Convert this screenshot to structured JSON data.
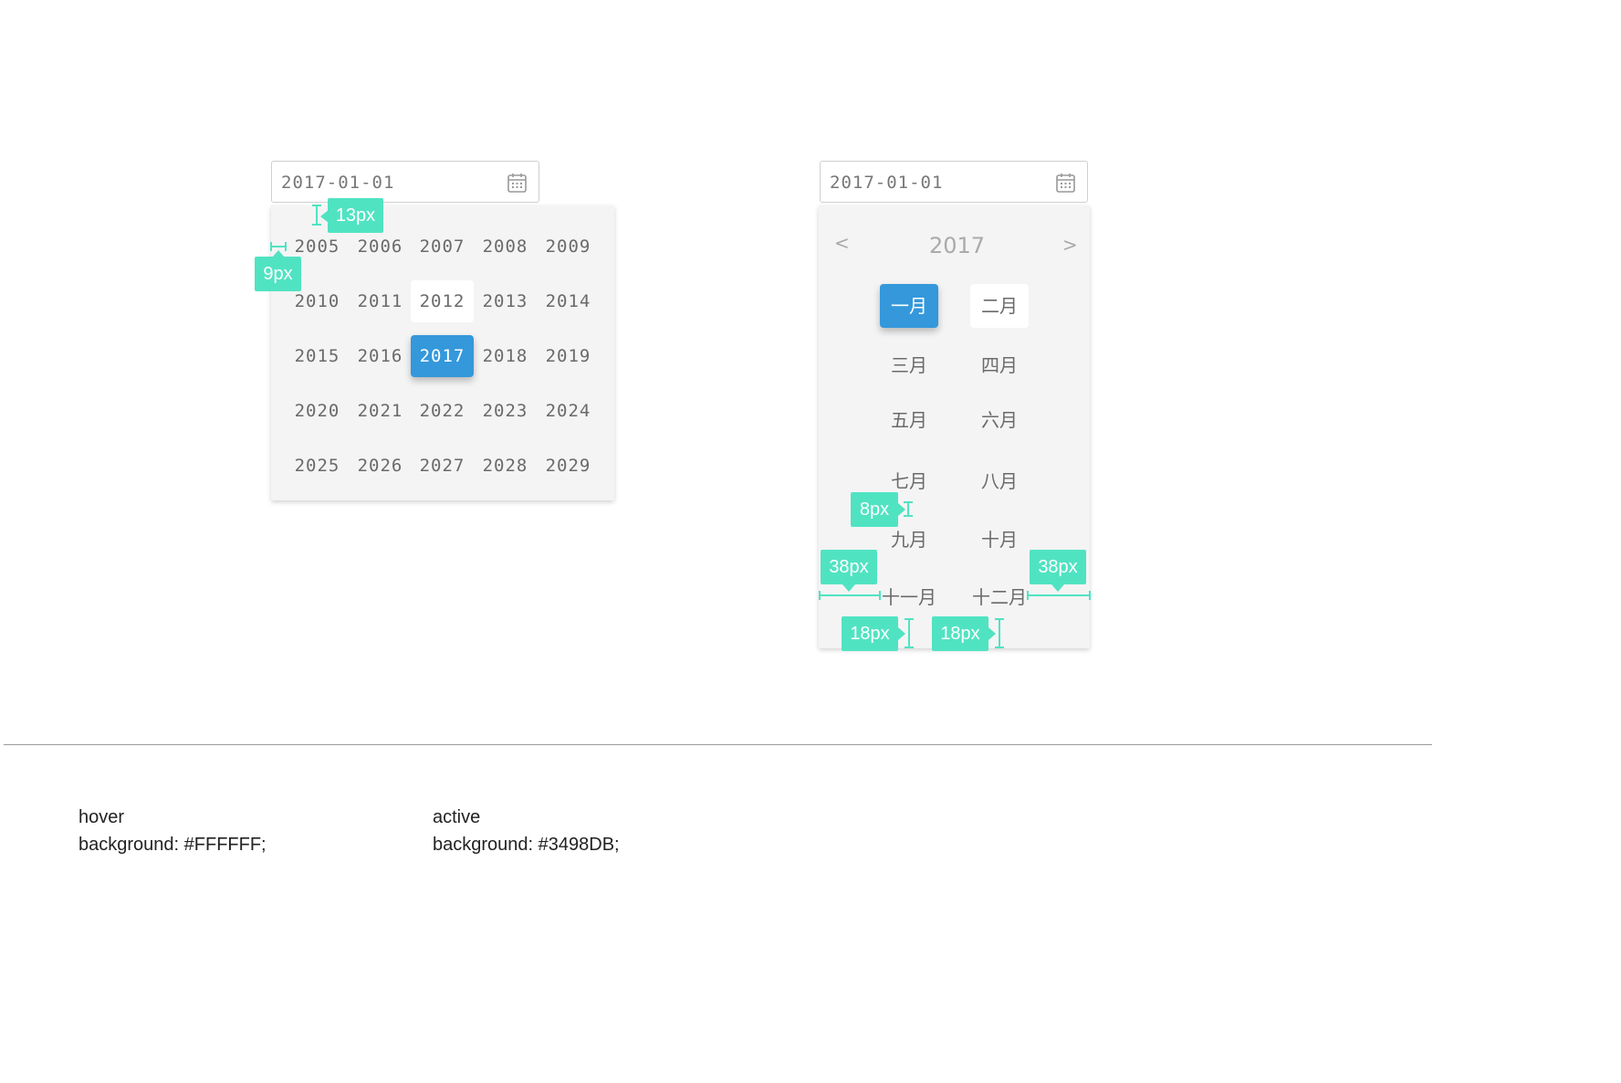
{
  "left_picker": {
    "input_value": "2017-01-01",
    "icon": "calendar-icon",
    "years": [
      [
        "2005",
        "2006",
        "2007",
        "2008",
        "2009"
      ],
      [
        "2010",
        "2011",
        "2012",
        "2013",
        "2014"
      ],
      [
        "2015",
        "2016",
        "2017",
        "2018",
        "2019"
      ],
      [
        "2020",
        "2021",
        "2022",
        "2023",
        "2024"
      ],
      [
        "2025",
        "2026",
        "2027",
        "2028",
        "2029"
      ]
    ],
    "hover_year": "2012",
    "active_year": "2017"
  },
  "right_picker": {
    "input_value": "2017-01-01",
    "icon": "calendar-icon",
    "prev_label": "<",
    "next_label": ">",
    "year_title": "2017",
    "months": [
      [
        "一月",
        "二月"
      ],
      [
        "三月",
        "四月"
      ],
      [
        "五月",
        "六月"
      ],
      [
        "七月",
        "八月"
      ],
      [
        "九月",
        "十月"
      ],
      [
        "十一月",
        "十二月"
      ]
    ],
    "active_month": "一月",
    "hover_month": "二月"
  },
  "annotations": {
    "top_gap": "13px",
    "left_gap": "9px",
    "row_gap": "8px",
    "left_margin": "38px",
    "right_margin": "38px",
    "bottom_gap_1": "18px",
    "bottom_gap_2": "18px"
  },
  "notes": {
    "hover_title": "hover",
    "hover_value": "background: #FFFFFF;",
    "active_title": "active",
    "active_value": "background: #3498DB;"
  },
  "colors": {
    "hover": "#FFFFFF",
    "active": "#3498DB",
    "annotation": "#50E3C2",
    "panel": "#F4F4F4"
  }
}
